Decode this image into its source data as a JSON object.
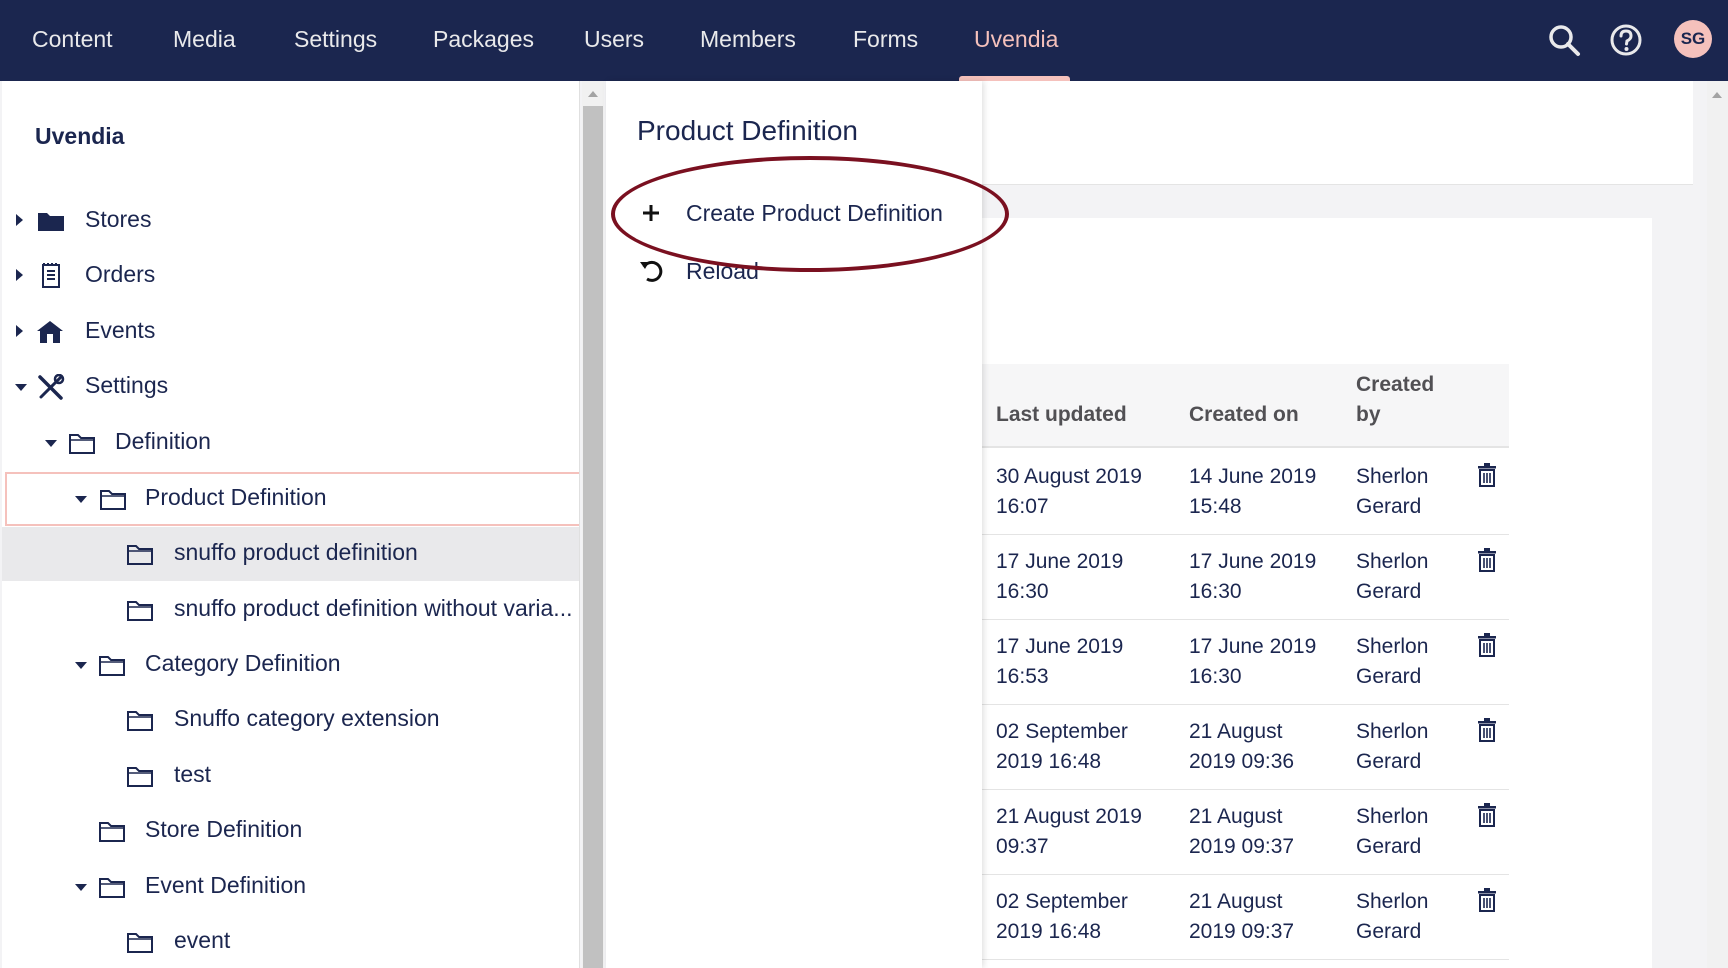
{
  "nav": {
    "items": [
      "Content",
      "Media",
      "Settings",
      "Packages",
      "Users",
      "Members",
      "Forms",
      "Uvendia"
    ],
    "active": "Uvendia",
    "avatar_initials": "SG",
    "icons": [
      "search-icon",
      "help-icon"
    ]
  },
  "tree": {
    "title": "Uvendia",
    "items": [
      {
        "label": "Stores",
        "icon": "folder-solid-icon"
      },
      {
        "label": "Orders",
        "icon": "receipt-icon"
      },
      {
        "label": "Events",
        "icon": "tent-icon"
      },
      {
        "label": "Settings",
        "icon": "tools-icon"
      },
      {
        "label": "Definition",
        "icon": "folder-icon"
      },
      {
        "label": "Product Definition",
        "icon": "folder-icon"
      },
      {
        "label": "snuffo product definition",
        "icon": "folder-icon"
      },
      {
        "label": "snuffo product definition without varia...",
        "icon": "folder-icon"
      },
      {
        "label": "Category Definition",
        "icon": "folder-icon"
      },
      {
        "label": "Snuffo category extension",
        "icon": "folder-icon"
      },
      {
        "label": "test",
        "icon": "folder-icon"
      },
      {
        "label": "Store Definition",
        "icon": "folder-icon"
      },
      {
        "label": "Event Definition",
        "icon": "folder-icon"
      },
      {
        "label": "event",
        "icon": "folder-icon"
      }
    ]
  },
  "menu": {
    "title": "Product Definition",
    "items": [
      {
        "label": "Create Product Definition",
        "icon": "plus-icon"
      },
      {
        "label": "Reload",
        "icon": "reload-icon"
      }
    ]
  },
  "table": {
    "headers": {
      "last_updated": "Last updated",
      "created_on": "Created on",
      "created_by_1": "Created",
      "created_by_2": "by"
    },
    "rows": [
      {
        "updated_1": "30 August 2019",
        "updated_2": "16:07",
        "created_1": "14 June 2019",
        "created_2": "15:48",
        "by_1": "Sherlon",
        "by_2": "Gerard"
      },
      {
        "updated_1": "17 June 2019",
        "updated_2": "16:30",
        "created_1": "17 June 2019",
        "created_2": "16:30",
        "by_1": "Sherlon",
        "by_2": "Gerard"
      },
      {
        "updated_1": "17 June 2019",
        "updated_2": "16:53",
        "created_1": "17 June 2019",
        "created_2": "16:30",
        "by_1": "Sherlon",
        "by_2": "Gerard"
      },
      {
        "updated_1": "02 September",
        "updated_2": "2019 16:48",
        "created_1": "21 August",
        "created_2": "2019 09:36",
        "by_1": "Sherlon",
        "by_2": "Gerard"
      },
      {
        "updated_1": "21 August 2019",
        "updated_2": "09:37",
        "created_1": "21 August",
        "created_2": "2019 09:37",
        "by_1": "Sherlon",
        "by_2": "Gerard"
      },
      {
        "updated_1": "02 September",
        "updated_2": "2019 16:48",
        "created_1": "21 August",
        "created_2": "2019 09:37",
        "by_1": "Sherlon",
        "by_2": "Gerard"
      }
    ]
  },
  "colors": {
    "nav_bg": "#1b264f",
    "accent": "#f5c1bc",
    "annotation": "#7a1020"
  }
}
